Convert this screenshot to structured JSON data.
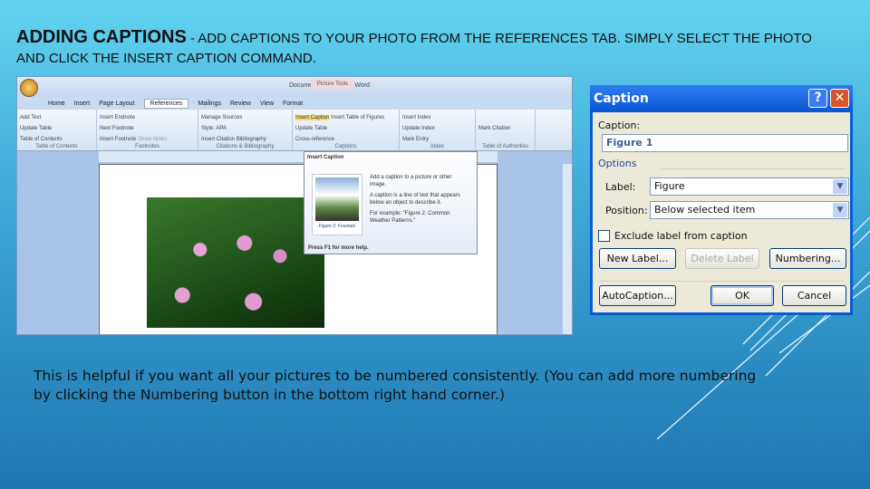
{
  "slide": {
    "title": "ADDING CAPTIONS",
    "subtitle": "- ADD CAPTIONS TO YOUR PHOTO FROM THE REFERENCES TAB. SIMPLY SELECT THE PHOTO AND CLICK THE INSERT CAPTION COMMAND.",
    "body": "This is helpful if you want all your pictures to be numbered consistently. (You can add more numbering by clicking the Numbering button in the bottom right hand corner.)"
  },
  "word": {
    "doc_title": "Document1 - Microsoft Word",
    "picture_tools": "Picture Tools",
    "tabs": [
      "Home",
      "Insert",
      "Page Layout",
      "References",
      "Mailings",
      "Review",
      "View",
      "Format"
    ],
    "groups": [
      {
        "label": "Table of Contents",
        "items": [
          "Table of Contents",
          "Add Text",
          "Update Table"
        ]
      },
      {
        "label": "Footnotes",
        "items": [
          "Insert Footnote",
          "Insert Endnote",
          "Next Footnote",
          "Show Notes"
        ]
      },
      {
        "label": "Citations & Bibliography",
        "items": [
          "Insert Citation",
          "Manage Sources",
          "Style: APA",
          "Bibliography"
        ]
      },
      {
        "label": "Captions",
        "items": [
          "Insert Caption",
          "Insert Table of Figures",
          "Update Table",
          "Cross-reference"
        ]
      },
      {
        "label": "Index",
        "items": [
          "Mark Entry",
          "Insert Index",
          "Update Index"
        ]
      },
      {
        "label": "Table of Authorities",
        "items": [
          "Mark Citation"
        ]
      }
    ],
    "tooltip": {
      "title": "Insert Caption",
      "p1": "Add a caption to a picture or other image.",
      "p2": "A caption is a line of text that appears below an object to describe it.",
      "p3": "For example: \"Figure 2: Common Weather Patterns.\"",
      "img_caption": "Figure 2: Fountain",
      "help": "Press F1 for more help."
    }
  },
  "dialog": {
    "title": "Caption",
    "help": "?",
    "close": "✕",
    "caption_label": "Caption:",
    "caption_value": "Figure 1",
    "options": "Options",
    "label_label": "Label:",
    "label_value": "Figure",
    "position_label": "Position:",
    "position_value": "Below selected item",
    "exclude": "Exclude label from caption",
    "new_label": "New Label...",
    "delete_label": "Delete Label",
    "numbering": "Numbering...",
    "autocaption": "AutoCaption...",
    "ok": "OK",
    "cancel": "Cancel"
  }
}
